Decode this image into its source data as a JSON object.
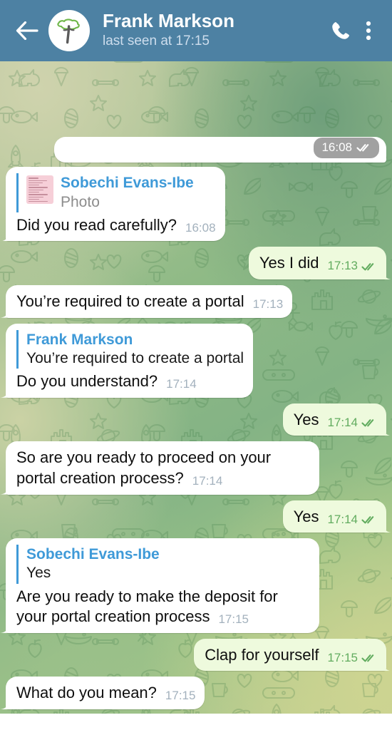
{
  "header": {
    "back_icon": "back-arrow-icon",
    "avatar_icon": "tree-avatar-icon",
    "title": "Frank Markson",
    "status": "last seen at 17:15",
    "call_icon": "phone-icon",
    "menu_icon": "more-vertical-icon"
  },
  "colors": {
    "header_bg": "#4d81a3",
    "incoming_bubble": "#ffffff",
    "outgoing_bubble": "#eefadd",
    "quote_accent": "#3f9ad8",
    "outgoing_meta": "#62ac5f",
    "incoming_meta": "#a3b1bd"
  },
  "messages": [
    {
      "id": "m0",
      "direction": "out",
      "type": "photo",
      "text": "",
      "time": "16:08",
      "status_icon": "double-check-icon"
    },
    {
      "id": "m1",
      "direction": "in",
      "type": "text",
      "quote": {
        "name": "Sobechi Evans-Ibe",
        "snippet": "Photo",
        "thumb": "photo-thumbnail",
        "snippet_style": "muted"
      },
      "text": "Did you read carefully?",
      "time": "16:08"
    },
    {
      "id": "m2",
      "direction": "out",
      "type": "text",
      "text": "Yes I did",
      "time": "17:13",
      "status_icon": "double-check-icon"
    },
    {
      "id": "m3",
      "direction": "in",
      "type": "text",
      "text": "You’re required to create a portal",
      "time": "17:13"
    },
    {
      "id": "m4",
      "direction": "in",
      "type": "text",
      "quote": {
        "name": "Frank Markson",
        "snippet": "You’re required to create a portal",
        "snippet_style": "plain"
      },
      "text": "Do you understand?",
      "time": "17:14"
    },
    {
      "id": "m5",
      "direction": "out",
      "type": "text",
      "text": "Yes",
      "time": "17:14",
      "status_icon": "double-check-icon"
    },
    {
      "id": "m6",
      "direction": "in",
      "type": "text",
      "text": "So are you ready to proceed on your portal creation process?",
      "time": "17:14"
    },
    {
      "id": "m7",
      "direction": "out",
      "type": "text",
      "text": "Yes",
      "time": "17:14",
      "status_icon": "double-check-icon"
    },
    {
      "id": "m8",
      "direction": "in",
      "type": "text",
      "quote": {
        "name": "Sobechi Evans-Ibe",
        "snippet": "Yes",
        "snippet_style": "plain"
      },
      "text": "Are you ready to make the deposit for your portal creation process",
      "time": "17:15"
    },
    {
      "id": "m9",
      "direction": "out",
      "type": "text",
      "text": "Clap for yourself",
      "time": "17:15",
      "status_icon": "double-check-icon"
    },
    {
      "id": "m10",
      "direction": "in",
      "type": "text",
      "text": "What do you mean?",
      "time": "17:15"
    }
  ]
}
